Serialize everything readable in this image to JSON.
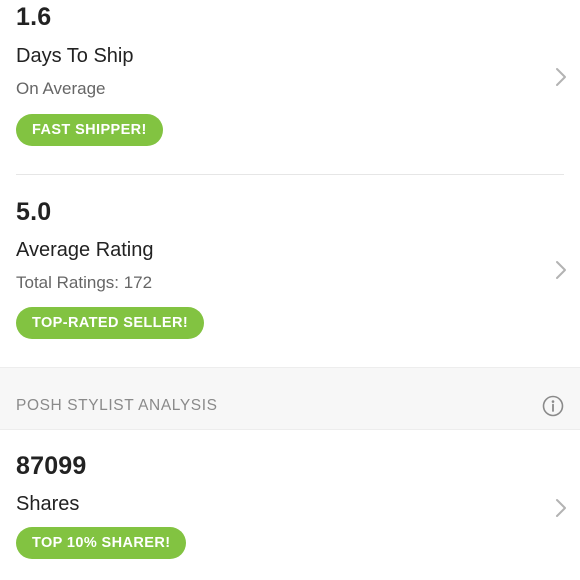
{
  "shipping": {
    "value": "1.6",
    "title": "Days To Ship",
    "subtitle": "On Average",
    "badge": "FAST SHIPPER!"
  },
  "rating": {
    "value": "5.0",
    "title": "Average Rating",
    "subtitle": "Total Ratings: 172",
    "badge": "TOP-RATED SELLER!"
  },
  "section": {
    "title": "POSH STYLIST ANALYSIS",
    "icon": "info-icon"
  },
  "shares": {
    "value": "87099",
    "title": "Shares",
    "badge": "TOP 10% SHARER!"
  },
  "colors": {
    "badge": "#82c341",
    "chevron": "#b3b3b3",
    "section_bg": "#f7f7f7"
  }
}
